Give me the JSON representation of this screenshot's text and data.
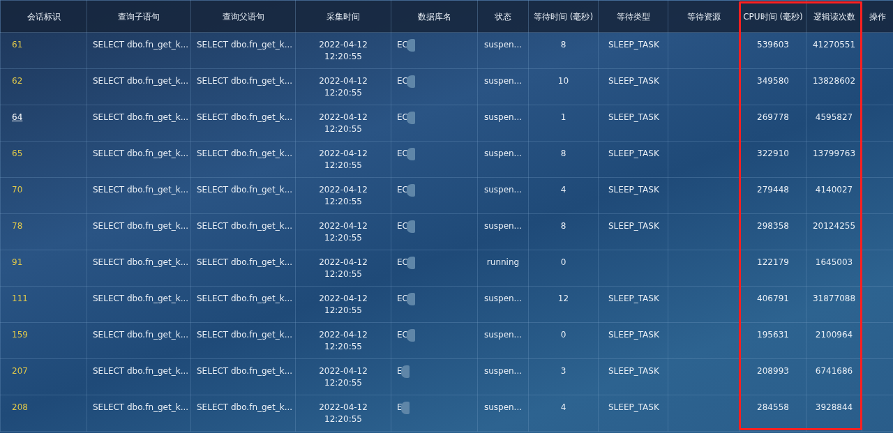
{
  "table": {
    "columns": [
      {
        "label": "会话标识",
        "highlighted": false
      },
      {
        "label": "查询子语句",
        "highlighted": false
      },
      {
        "label": "查询父语句",
        "highlighted": false
      },
      {
        "label": "采集时间",
        "highlighted": false
      },
      {
        "label": "数据库名",
        "highlighted": false
      },
      {
        "label": "状态",
        "highlighted": false
      },
      {
        "label": "等待时间 (毫秒)",
        "highlighted": false
      },
      {
        "label": "等待类型",
        "highlighted": false
      },
      {
        "label": "等待资源",
        "highlighted": false
      },
      {
        "label": "CPU时间 (毫秒)",
        "highlighted": true
      },
      {
        "label": "逻辑读次数",
        "highlighted": true
      },
      {
        "label": "操作",
        "highlighted": false
      }
    ],
    "rows": [
      {
        "id": "61",
        "hovered": false,
        "child": "SELECT dbo.fn_get_k...",
        "parent": "SELECT dbo.fn_get_k...",
        "date": "2022-04-12",
        "time": "12:20:55",
        "db": "EC",
        "status": "suspen...",
        "wait": "8",
        "wait_type": "SLEEP_TASK",
        "cpu": "539603",
        "reads": "41270551"
      },
      {
        "id": "62",
        "hovered": false,
        "child": "SELECT dbo.fn_get_k...",
        "parent": "SELECT dbo.fn_get_k...",
        "date": "2022-04-12",
        "time": "12:20:55",
        "db": "EC",
        "status": "suspen...",
        "wait": "10",
        "wait_type": "SLEEP_TASK",
        "cpu": "349580",
        "reads": "13828602"
      },
      {
        "id": "64",
        "hovered": true,
        "child": "SELECT dbo.fn_get_k...",
        "parent": "SELECT dbo.fn_get_k...",
        "date": "2022-04-12",
        "time": "12:20:55",
        "db": "EC",
        "status": "suspen...",
        "wait": "1",
        "wait_type": "SLEEP_TASK",
        "cpu": "269778",
        "reads": "4595827"
      },
      {
        "id": "65",
        "hovered": false,
        "child": "SELECT dbo.fn_get_k...",
        "parent": "SELECT dbo.fn_get_k...",
        "date": "2022-04-12",
        "time": "12:20:55",
        "db": "EC",
        "status": "suspen...",
        "wait": "8",
        "wait_type": "SLEEP_TASK",
        "cpu": "322910",
        "reads": "13799763"
      },
      {
        "id": "70",
        "hovered": false,
        "child": "SELECT dbo.fn_get_k...",
        "parent": "SELECT dbo.fn_get_k...",
        "date": "2022-04-12",
        "time": "12:20:55",
        "db": "EC",
        "status": "suspen...",
        "wait": "4",
        "wait_type": "SLEEP_TASK",
        "cpu": "279448",
        "reads": "4140027"
      },
      {
        "id": "78",
        "hovered": false,
        "child": "SELECT dbo.fn_get_k...",
        "parent": "SELECT dbo.fn_get_k...",
        "date": "2022-04-12",
        "time": "12:20:55",
        "db": "EC",
        "status": "suspen...",
        "wait": "8",
        "wait_type": "SLEEP_TASK",
        "cpu": "298358",
        "reads": "20124255"
      },
      {
        "id": "91",
        "hovered": false,
        "child": "SELECT dbo.fn_get_k...",
        "parent": "SELECT dbo.fn_get_k...",
        "date": "2022-04-12",
        "time": "12:20:55",
        "db": "EC",
        "status": "running",
        "wait": "0",
        "cpu": "122179",
        "reads": "1645003"
      },
      {
        "id": "111",
        "hovered": false,
        "child": "SELECT dbo.fn_get_k...",
        "parent": "SELECT dbo.fn_get_k...",
        "date": "2022-04-12",
        "time": "12:20:55",
        "db": "EC",
        "status": "suspen...",
        "wait": "12",
        "wait_type": "SLEEP_TASK",
        "cpu": "406791",
        "reads": "31877088"
      },
      {
        "id": "159",
        "hovered": false,
        "child": "SELECT dbo.fn_get_k...",
        "parent": "SELECT dbo.fn_get_k...",
        "date": "2022-04-12",
        "time": "12:20:55",
        "db": "EC",
        "status": "suspen...",
        "wait": "0",
        "wait_type": "SLEEP_TASK",
        "cpu": "195631",
        "reads": "2100964"
      },
      {
        "id": "207",
        "hovered": false,
        "child": "SELECT dbo.fn_get_k...",
        "parent": "SELECT dbo.fn_get_k...",
        "date": "2022-04-12",
        "time": "12:20:55",
        "db": "E",
        "status": "suspen...",
        "wait": "3",
        "wait_type": "SLEEP_TASK",
        "cpu": "208993",
        "reads": "6741686"
      },
      {
        "id": "208",
        "hovered": false,
        "child": "SELECT dbo.fn_get_k...",
        "parent": "SELECT dbo.fn_get_k...",
        "date": "2022-04-12",
        "time": "12:20:55",
        "db": "E",
        "status": "suspen...",
        "wait": "4",
        "wait_type": "SLEEP_TASK",
        "cpu": "284558",
        "reads": "3928844"
      }
    ]
  }
}
